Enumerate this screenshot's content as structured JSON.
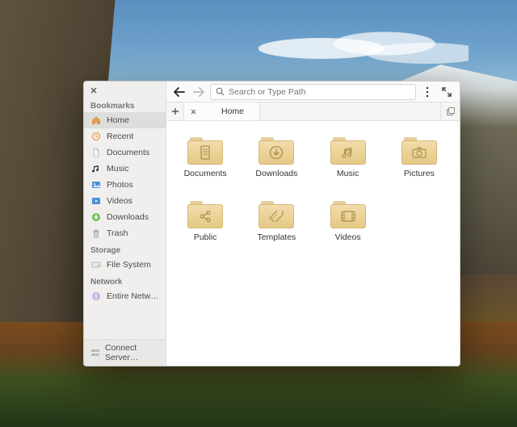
{
  "sidebar": {
    "sections": [
      {
        "label": "Bookmarks",
        "items": [
          {
            "label": "Home",
            "icon": "home-icon",
            "selected": true
          },
          {
            "label": "Recent",
            "icon": "recent-icon",
            "selected": false
          },
          {
            "label": "Documents",
            "icon": "documents-icon",
            "selected": false
          },
          {
            "label": "Music",
            "icon": "music-icon",
            "selected": false
          },
          {
            "label": "Photos",
            "icon": "photos-icon",
            "selected": false
          },
          {
            "label": "Videos",
            "icon": "videos-icon",
            "selected": false
          },
          {
            "label": "Downloads",
            "icon": "downloads-icon",
            "selected": false
          },
          {
            "label": "Trash",
            "icon": "trash-icon",
            "selected": false
          }
        ]
      },
      {
        "label": "Storage",
        "items": [
          {
            "label": "File System",
            "icon": "drive-icon",
            "selected": false
          }
        ]
      },
      {
        "label": "Network",
        "items": [
          {
            "label": "Entire Network",
            "icon": "network-icon",
            "selected": false
          }
        ]
      }
    ],
    "footer_label": "Connect Server…"
  },
  "toolbar": {
    "search_placeholder": "Search or Type Path"
  },
  "tabs": {
    "active_label": "Home"
  },
  "folders": [
    {
      "label": "Documents",
      "glyph": "doc"
    },
    {
      "label": "Downloads",
      "glyph": "download"
    },
    {
      "label": "Music",
      "glyph": "music"
    },
    {
      "label": "Pictures",
      "glyph": "camera"
    },
    {
      "label": "Public",
      "glyph": "share"
    },
    {
      "label": "Templates",
      "glyph": "ruler"
    },
    {
      "label": "Videos",
      "glyph": "film"
    }
  ]
}
